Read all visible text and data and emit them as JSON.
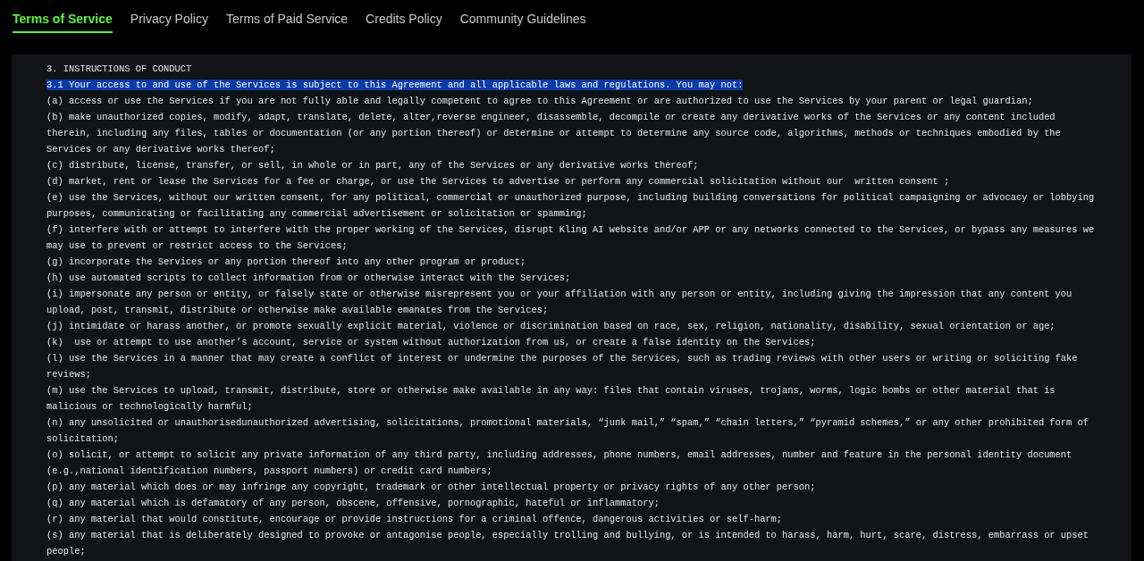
{
  "tabs": [
    {
      "label": "Terms of Service",
      "selected": true
    },
    {
      "label": "Privacy Policy",
      "selected": false
    },
    {
      "label": "Terms of Paid Service",
      "selected": false
    },
    {
      "label": "Credits Policy",
      "selected": false
    },
    {
      "label": "Community Guidelines",
      "selected": false
    }
  ],
  "document": {
    "heading": "3. INSTRUCTIONS OF CONDUCT",
    "paragraphs": [
      {
        "text": "3.1 Your access to and use of the Services is subject to this Agreement and all applicable laws and regulations. You may not:",
        "highlighted": true
      },
      {
        "text": "(a) access or use the Services if you are not fully able and legally competent to agree to this Agreement or are authorized to use the Services by your parent or legal guardian;",
        "highlighted": false
      },
      {
        "text": "(b) make unauthorized copies, modify, adapt, translate, delete, alter,reverse engineer, disassemble, decompile or create any derivative works of the Services or any content included therein, including any files, tables or documentation (or any portion thereof) or determine or attempt to determine any source code, algorithms, methods or techniques embodied by the Services or any derivative works thereof;",
        "highlighted": false
      },
      {
        "text": "(c) distribute, license, transfer, or sell, in whole or in part, any of the Services or any derivative works thereof;",
        "highlighted": false
      },
      {
        "text": "(d) market, rent or lease the Services for a fee or charge, or use the Services to advertise or perform any commercial solicitation without our  written consent ;",
        "highlighted": false
      },
      {
        "text": "(e) use the Services, without our written consent, for any political, commercial or unauthorized purpose, including building conversations for political campaigning or advocacy or lobbying purposes, communicating or facilitating any commercial advertisement or solicitation or spamming;",
        "highlighted": false
      },
      {
        "text": "(f) interfere with or attempt to interfere with the proper working of the Services, disrupt Kling AI website and/or APP or any networks connected to the Services, or bypass any measures we may use to prevent or restrict access to the Services;",
        "highlighted": false
      },
      {
        "text": "(g) incorporate the Services or any portion thereof into any other program or product;",
        "highlighted": false
      },
      {
        "text": "(h) use automated scripts to collect information from or otherwise interact with the Services;",
        "highlighted": false
      },
      {
        "text": "(i) impersonate any person or entity, or falsely state or otherwise misrepresent you or your affiliation with any person or entity, including giving the impression that any content you upload, post, transmit, distribute or otherwise make available emanates from the Services;",
        "highlighted": false
      },
      {
        "text": "(j) intimidate or harass another, or promote sexually explicit material, violence or discrimination based on race, sex, religion, nationality, disability, sexual orientation or age;",
        "highlighted": false
      },
      {
        "text": "(k)  use or attempt to use another’s account, service or system without authorization from us, or create a false identity on the Services;",
        "highlighted": false
      },
      {
        "text": "(l) use the Services in a manner that may create a conflict of interest or undermine the purposes of the Services, such as trading reviews with other users or writing or soliciting fake reviews;",
        "highlighted": false
      },
      {
        "text": "(m) use the Services to upload, transmit, distribute, store or otherwise make available in any way: files that contain viruses, trojans, worms, logic bombs or other material that is malicious or technologically harmful;",
        "highlighted": false
      },
      {
        "text": "(n) any unsolicited or unauthorisedunauthorized advertising, solicitations, promotional materials, “junk mail,” “spam,” “chain letters,” “pyramid schemes,” or any other prohibited form of solicitation;",
        "highlighted": false
      },
      {
        "text": "(o) solicit, or attempt to solicit any private information of any third party, including addresses, phone numbers, email addresses, number and feature in the personal identity document (e.g.,national identification numbers, passport numbers) or credit card numbers;",
        "highlighted": false
      },
      {
        "text": "(p) any material which does or may infringe any copyright, trademark or other intellectual property or privacy rights of any other person;",
        "highlighted": false
      },
      {
        "text": "(q) any material which is defamatory of any person, obscene, offensive, pornographic, hateful or inflammatory;",
        "highlighted": false
      },
      {
        "text": "(r) any material that would constitute, encourage or provide instructions for a criminal offence, dangerous activities or self-harm;",
        "highlighted": false
      },
      {
        "text": "(s) any material that is deliberately designed to provoke or antagonise people, especially trolling and bullying, or is intended to harass, harm, hurt, scare, distress, embarrass or upset people;",
        "highlighted": false
      }
    ]
  }
}
